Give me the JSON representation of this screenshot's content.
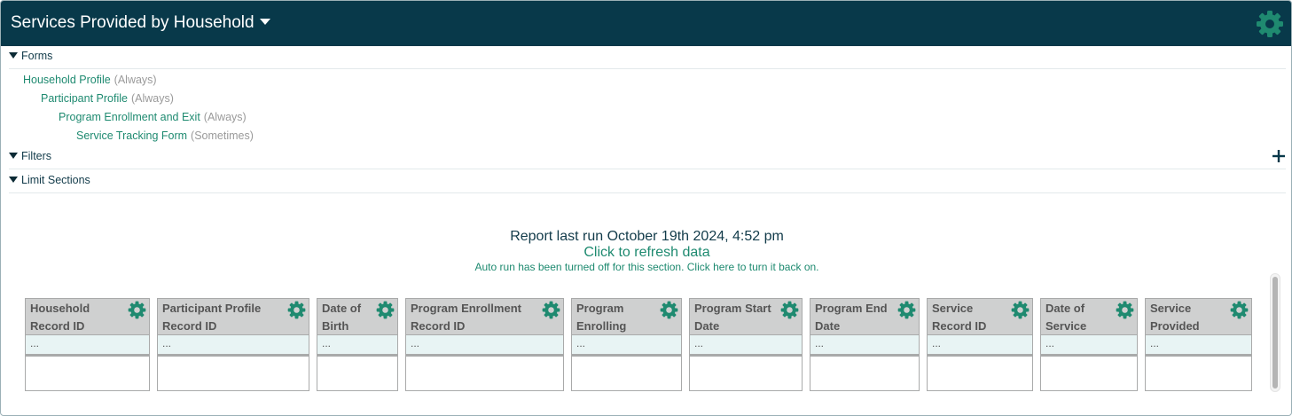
{
  "header": {
    "title": "Services Provided by Household",
    "menu_icon": "caret-down-icon",
    "settings_icon": "gear-icon"
  },
  "sections": {
    "forms_label": "Forms",
    "filters_label": "Filters",
    "limit_label": "Limit Sections"
  },
  "forms": [
    {
      "name": "Household Profile",
      "frequency": "(Always)"
    },
    {
      "name": "Participant Profile",
      "frequency": "(Always)"
    },
    {
      "name": "Program Enrollment and Exit",
      "frequency": "(Always)"
    },
    {
      "name": "Service Tracking Form",
      "frequency": "(Sometimes)"
    }
  ],
  "filters_add_icon": "plus-icon",
  "report": {
    "last_run": "Report last run October 19th 2024, 4:52 pm",
    "refresh": "Click to refresh data",
    "autorun": "Auto run has been turned off for this section. Click here to turn it back on."
  },
  "columns": [
    {
      "line1": "Household",
      "line2": "Record ID",
      "placeholder": "..."
    },
    {
      "line1": "Participant Profile",
      "line2": "Record ID",
      "placeholder": "..."
    },
    {
      "line1": "Date of",
      "line2": "Birth",
      "placeholder": "..."
    },
    {
      "line1": "Program Enrollment",
      "line2": "Record ID",
      "placeholder": "..."
    },
    {
      "line1": "Program",
      "line2": "Enrolling",
      "placeholder": "..."
    },
    {
      "line1": "Program Start",
      "line2": "Date",
      "placeholder": "..."
    },
    {
      "line1": "Program End",
      "line2": "Date",
      "placeholder": "..."
    },
    {
      "line1": "Service",
      "line2": "Record ID",
      "placeholder": "..."
    },
    {
      "line1": "Date of",
      "line2": "Service",
      "placeholder": "..."
    },
    {
      "line1": "Service",
      "line2": "Provided",
      "placeholder": "..."
    }
  ],
  "colors": {
    "header_bg": "#08394a",
    "accent_green": "#1e8a70",
    "text_dark": "#123b4a",
    "column_header_bg": "#cfd0d0",
    "placeholder_row_bg": "#e8f4f4"
  }
}
